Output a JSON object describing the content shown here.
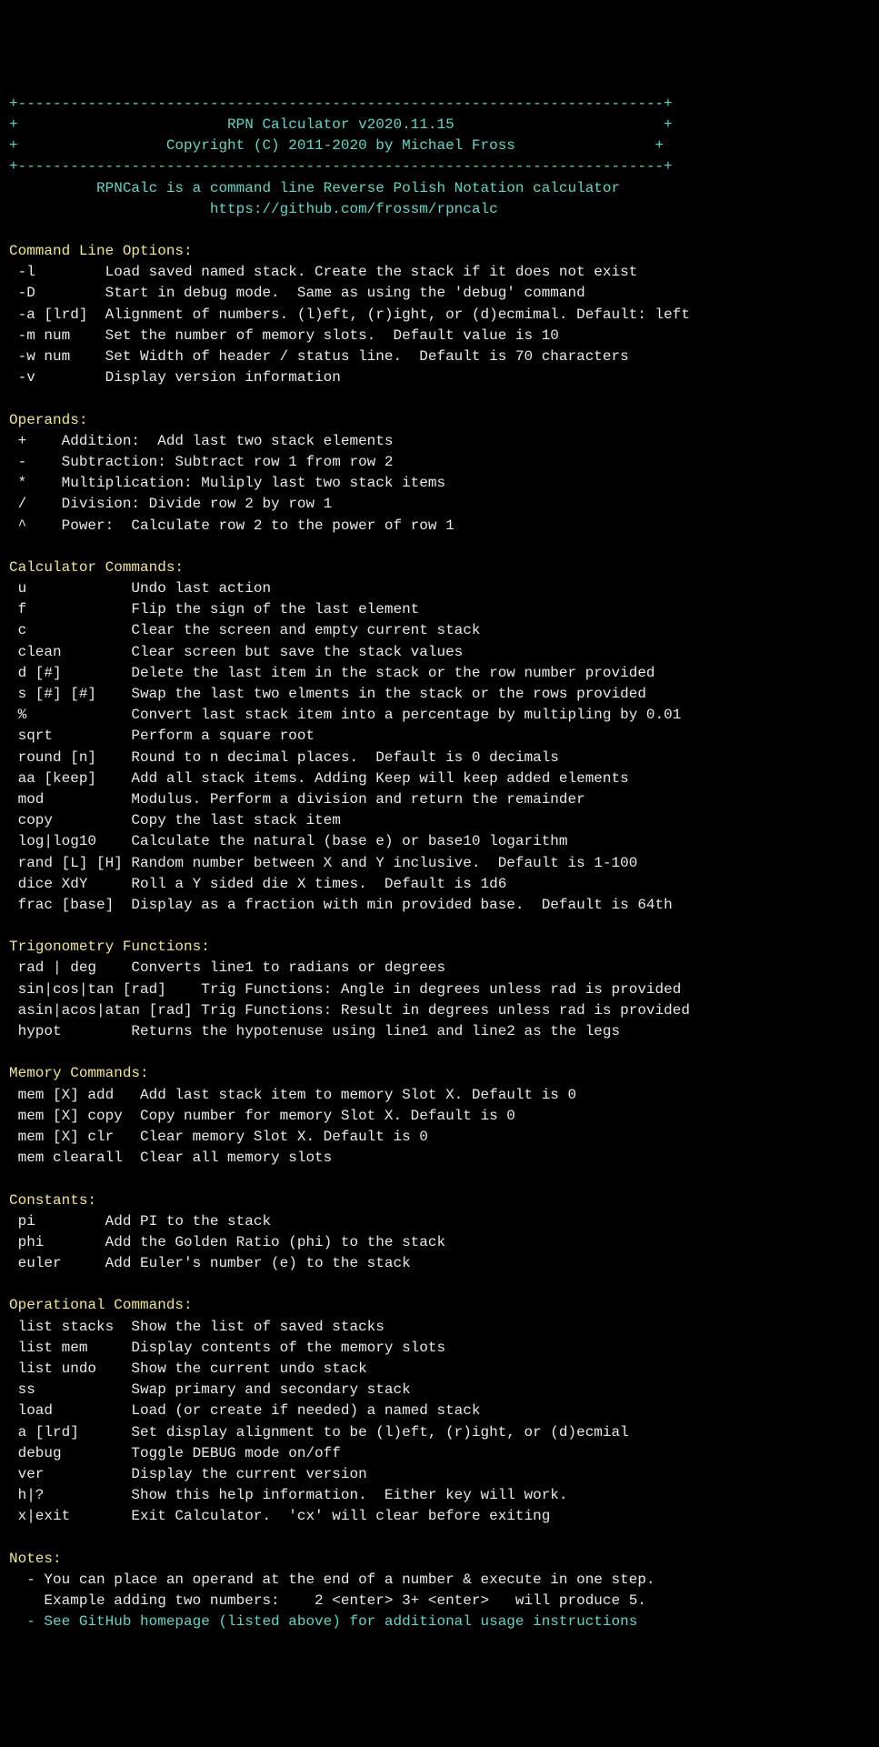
{
  "header": {
    "border_top": "+--------------------------------------------------------------------------+",
    "title_line": "+                        RPN Calculator v2020.11.15                        +",
    "copyright_line": "+                 Copyright (C) 2011-2020 by Michael Fross                +",
    "border_bottom": "+--------------------------------------------------------------------------+",
    "desc": "          RPNCalc is a command line Reverse Polish Notation calculator",
    "url": "                       https://github.com/frossm/rpncalc"
  },
  "cmdline": {
    "heading": "Command Line Options:",
    "lines": [
      " -l        Load saved named stack. Create the stack if it does not exist",
      " -D        Start in debug mode.  Same as using the 'debug' command",
      " -a [lrd]  Alignment of numbers. (l)eft, (r)ight, or (d)ecmimal. Default: left",
      " -m num    Set the number of memory slots.  Default value is 10",
      " -w num    Set Width of header / status line.  Default is 70 characters",
      " -v        Display version information"
    ]
  },
  "operands": {
    "heading": "Operands:",
    "lines": [
      " +    Addition:  Add last two stack elements",
      " -    Subtraction: Subtract row 1 from row 2",
      " *    Multiplication: Muliply last two stack items",
      " /    Division: Divide row 2 by row 1",
      " ^    Power:  Calculate row 2 to the power of row 1"
    ]
  },
  "calc": {
    "heading": "Calculator Commands:",
    "lines": [
      " u            Undo last action",
      " f            Flip the sign of the last element",
      " c            Clear the screen and empty current stack",
      " clean        Clear screen but save the stack values",
      " d [#]        Delete the last item in the stack or the row number provided",
      " s [#] [#]    Swap the last two elments in the stack or the rows provided",
      " %            Convert last stack item into a percentage by multipling by 0.01",
      " sqrt         Perform a square root",
      " round [n]    Round to n decimal places.  Default is 0 decimals",
      " aa [keep]    Add all stack items. Adding Keep will keep added elements",
      " mod          Modulus. Perform a division and return the remainder",
      " copy         Copy the last stack item",
      " log|log10    Calculate the natural (base e) or base10 logarithm",
      " rand [L] [H] Random number between X and Y inclusive.  Default is 1-100",
      " dice XdY     Roll a Y sided die X times.  Default is 1d6",
      " frac [base]  Display as a fraction with min provided base.  Default is 64th"
    ]
  },
  "trig": {
    "heading": "Trigonometry Functions:",
    "lines": [
      " rad | deg    Converts line1 to radians or degrees",
      " sin|cos|tan [rad]    Trig Functions: Angle in degrees unless rad is provided",
      " asin|acos|atan [rad] Trig Functions: Result in degrees unless rad is provided",
      " hypot        Returns the hypotenuse using line1 and line2 as the legs"
    ]
  },
  "memory": {
    "heading": "Memory Commands:",
    "lines": [
      " mem [X] add   Add last stack item to memory Slot X. Default is 0",
      " mem [X] copy  Copy number for memory Slot X. Default is 0",
      " mem [X] clr   Clear memory Slot X. Default is 0",
      " mem clearall  Clear all memory slots"
    ]
  },
  "constants": {
    "heading": "Constants:",
    "lines": [
      " pi        Add PI to the stack",
      " phi       Add the Golden Ratio (phi) to the stack",
      " euler     Add Euler's number (e) to the stack"
    ]
  },
  "operational": {
    "heading": "Operational Commands:",
    "lines": [
      " list stacks  Show the list of saved stacks",
      " list mem     Display contents of the memory slots",
      " list undo    Show the current undo stack",
      " ss           Swap primary and secondary stack",
      " load         Load (or create if needed) a named stack",
      " a [lrd]      Set display alignment to be (l)eft, (r)ight, or (d)ecmial",
      " debug        Toggle DEBUG mode on/off",
      " ver          Display the current version",
      " h|?          Show this help information.  Either key will work.",
      " x|exit       Exit Calculator.  'cx' will clear before exiting"
    ]
  },
  "notes": {
    "heading": "Notes:",
    "white_lines": [
      "  - You can place an operand at the end of a number & execute in one step.",
      "    Example adding two numbers:    2 <enter> 3+ <enter>   will produce 5."
    ],
    "cyan_line": "  - See GitHub homepage (listed above) for additional usage instructions"
  }
}
